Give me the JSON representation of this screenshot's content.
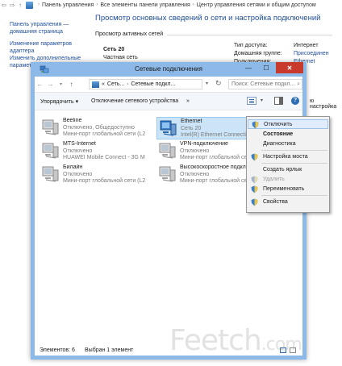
{
  "background": {
    "breadcrumb": [
      "Панель управления",
      "Все элементы панели управления",
      "Центр управления сетями и общим доступом"
    ],
    "left_links": {
      "home": "Панель управления — домашняя страница",
      "change_adapter": "Изменение параметров адаптера",
      "change_sharing_partial": "Изменить дополнительные параметры"
    },
    "title": "Просмотр основных сведений о сети и настройка подключений",
    "active_networks_label": "Просмотр активных сетей",
    "network_name": "Сеть 20",
    "network_type": "Частная сеть",
    "access_type_label": "Тип доступа:",
    "access_type_value": "Интернет",
    "homegroup_label": "Домашняя группе:",
    "homegroup_value": "Присоединен",
    "connections_label": "Подключения:",
    "connections_value": "Ethernet",
    "partial_text": "ю настройка"
  },
  "window": {
    "title": "Сетевые подключения",
    "address": {
      "prefix": "«",
      "crumb1": "Сеть...",
      "crumb2": "Сетевые подкл...",
      "more": "»"
    },
    "search_placeholder": "Поиск: Сетевые подкл...",
    "commands": {
      "organize": "Упорядочить ▾",
      "disable": "Отключение сетевого устройства",
      "more": "»"
    },
    "items": [
      {
        "name": "Beeline",
        "status": "Отключено, Общедоступно",
        "device": "Мини-порт глобальной сети (L2..."
      },
      {
        "name": "Ethernet",
        "status": "Сеть 20",
        "device": "Intel(R) Ethernet Connection I..."
      },
      {
        "name": "MTS-Internet",
        "status": "Отключено",
        "device": "HUAWEI Mobile Connect - 3G Mo..."
      },
      {
        "name": "VPN-подключение",
        "status": "Отключено",
        "device": "Мини-порт глобальной сети (L2..."
      },
      {
        "name": "Билайн",
        "status": "Отключено",
        "device": "Мини-порт глобальной сети (L2..."
      },
      {
        "name": "Высокоскоростное подключе...",
        "status": "Отключено",
        "device": "Мини-порт глобальной сети (РР..."
      }
    ],
    "status": {
      "count": "Элементов: 6",
      "selected": "Выбран 1 элемент"
    }
  },
  "context_menu": [
    {
      "label": "Отключить",
      "highlighted": true,
      "shield": true
    },
    {
      "label": "Состояние",
      "bold": true
    },
    {
      "label": "Диагностика"
    },
    {
      "label": "Настройка моста",
      "shield": true
    },
    {
      "label": "Создать ярлык"
    },
    {
      "label": "Удалить",
      "disabled": true,
      "shield": true
    },
    {
      "label": "Переименовать",
      "shield": true
    },
    {
      "label": "Свойства",
      "shield": true
    }
  ],
  "watermark": {
    "main": "Feetch",
    "suffix": ".com"
  },
  "colors": {
    "titlebar": "#8cb9e8",
    "close": "#c73a2c",
    "link": "#1f4e9a",
    "selection": "#cce4f7"
  }
}
